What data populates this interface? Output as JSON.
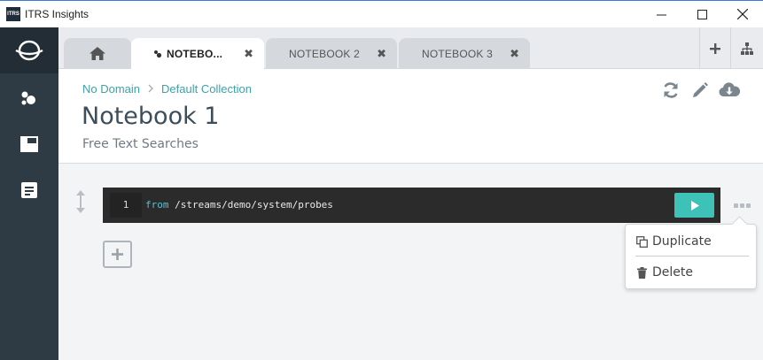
{
  "window": {
    "app_icon_text": "ITRS",
    "title": "ITRS Insights"
  },
  "tabs": [
    {
      "label": "",
      "icon": "home-icon"
    },
    {
      "label": "NOTEBO...",
      "icon": "notebook-icon",
      "active": true
    },
    {
      "label": "NOTEBOOK 2"
    },
    {
      "label": "NOTEBOOK 3"
    }
  ],
  "tab_close_glyph": "✖",
  "breadcrumb": {
    "domain": "No Domain",
    "collection": "Default Collection"
  },
  "page": {
    "title": "Notebook 1",
    "subtitle": "Free Text Searches"
  },
  "editor": {
    "line_number": "1",
    "keyword": "from",
    "path": " /streams/demo/system/probes"
  },
  "context_menu": {
    "duplicate": "Duplicate",
    "delete": "Delete"
  },
  "colors": {
    "accent": "#3aa3a8",
    "run_button": "#3ec2b8",
    "sidebar": "#2f3b44",
    "editor_bg": "#2b2b2b"
  }
}
